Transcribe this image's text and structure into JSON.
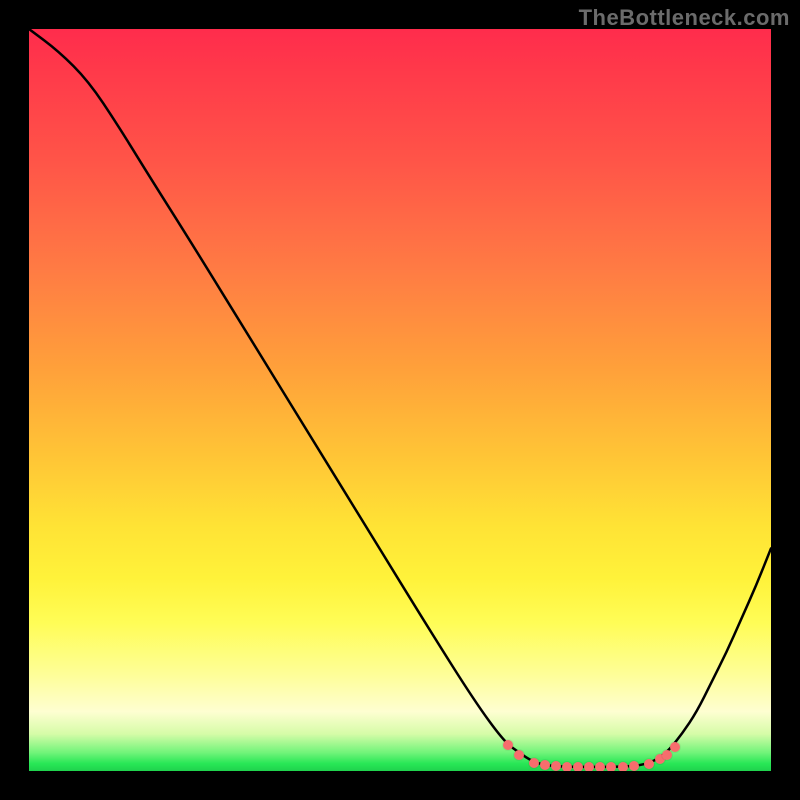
{
  "watermark": "TheBottleneck.com",
  "chart_data": {
    "type": "line",
    "title": "",
    "xlabel": "",
    "ylabel": "",
    "xlim": [
      0,
      100
    ],
    "ylim": [
      0,
      100
    ],
    "series": [
      {
        "name": "curve",
        "color": "#000000",
        "points": [
          [
            0.0,
            100.0
          ],
          [
            4.0,
            97.0
          ],
          [
            8.0,
            93.0
          ],
          [
            12.0,
            87.0
          ],
          [
            16.0,
            80.5
          ],
          [
            22.0,
            71.0
          ],
          [
            30.0,
            58.0
          ],
          [
            38.0,
            45.0
          ],
          [
            46.0,
            32.0
          ],
          [
            54.0,
            19.0
          ],
          [
            60.0,
            9.5
          ],
          [
            64.0,
            4.0
          ],
          [
            66.0,
            2.5
          ],
          [
            68.0,
            1.2
          ],
          [
            70.0,
            0.7
          ],
          [
            72.0,
            0.6
          ],
          [
            74.0,
            0.55
          ],
          [
            76.0,
            0.55
          ],
          [
            78.0,
            0.55
          ],
          [
            80.0,
            0.6
          ],
          [
            82.0,
            0.7
          ],
          [
            84.0,
            1.2
          ],
          [
            86.0,
            2.5
          ],
          [
            88.0,
            5.0
          ],
          [
            90.0,
            8.0
          ],
          [
            92.0,
            12.0
          ],
          [
            94.0,
            16.0
          ],
          [
            96.0,
            20.5
          ],
          [
            98.0,
            25.0
          ],
          [
            100.0,
            30.0
          ]
        ]
      }
    ],
    "markers": {
      "color": "#f76d6d",
      "points": [
        [
          64.5,
          3.5
        ],
        [
          66.0,
          2.2
        ],
        [
          68.0,
          1.1
        ],
        [
          69.5,
          0.8
        ],
        [
          71.0,
          0.7
        ],
        [
          72.5,
          0.6
        ],
        [
          74.0,
          0.55
        ],
        [
          75.5,
          0.55
        ],
        [
          77.0,
          0.55
        ],
        [
          78.5,
          0.55
        ],
        [
          80.0,
          0.6
        ],
        [
          81.5,
          0.7
        ],
        [
          83.5,
          1.0
        ],
        [
          85.0,
          1.6
        ],
        [
          86.0,
          2.2
        ],
        [
          87.0,
          3.2
        ]
      ]
    }
  }
}
